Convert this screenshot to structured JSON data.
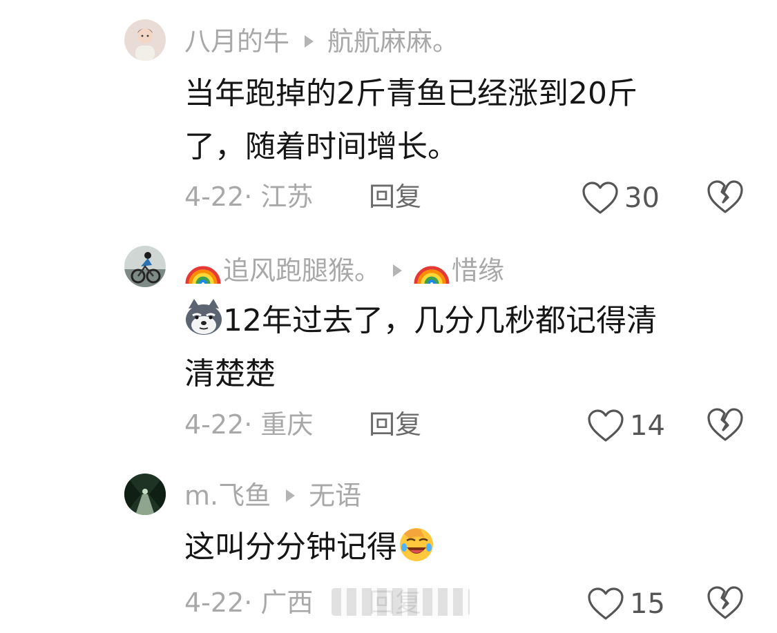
{
  "comments": [
    {
      "username": "八月的牛",
      "reply_to": "航航麻麻。",
      "content_lines": [
        "当年跑掉的2斤青鱼已经涨到20斤",
        "了，随着时间增长。"
      ],
      "date_location": "4-22· 江苏",
      "reply_label": "回复",
      "likes": "30",
      "avatar_icon": "avatar-person-photo"
    },
    {
      "username": "追风跑腿猴。",
      "username_prefix_icon": "rainbow-emoji",
      "reply_to": "惜缘",
      "reply_to_prefix_icon": "rainbow-emoji",
      "content_emoji": "husky-dog-emoji",
      "content_lines": [
        "12年过去了，几分几秒都记得清",
        "清楚楚"
      ],
      "date_location": "4-22· 重庆",
      "reply_label": "回复",
      "likes": "14",
      "avatar_icon": "avatar-cyclist-photo"
    },
    {
      "username": "m.飞鱼",
      "reply_to": "无语",
      "content_lines": [
        "这叫分分钟记得"
      ],
      "content_suffix_emoji": "facepalm-laugh-emoji",
      "date_location": "4-22· 广西",
      "reply_label": "回复",
      "likes": "15",
      "avatar_icon": "avatar-forest-path-photo"
    }
  ],
  "colors": {
    "muted_text": "#a8a8a8",
    "body_text": "#161616",
    "icon_gray": "#555555"
  }
}
